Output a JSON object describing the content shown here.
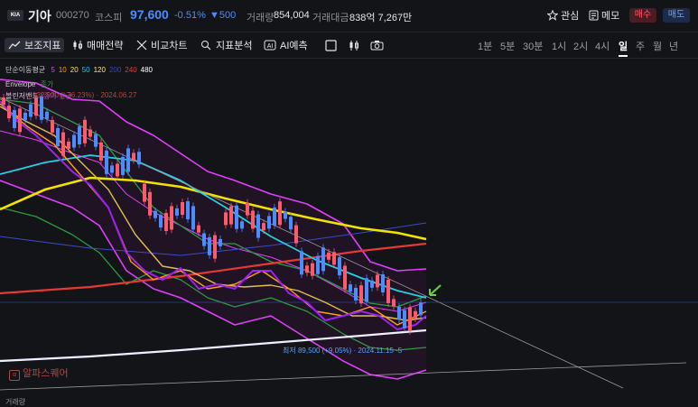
{
  "header": {
    "logo_text": "KIA",
    "name": "기아",
    "code": "000270",
    "market": "코스피",
    "price": "97,600",
    "change_rate": "-0.51%",
    "change_value": "▼500",
    "volume_label": "거래량",
    "volume": "854,004",
    "amount_label": "거래대금",
    "amount": "838억 7,267만",
    "watch_label": "관심",
    "memo_label": "메모",
    "buy_label": "매수",
    "sell_label": "매도"
  },
  "toolbar": {
    "tools": [
      "보조지표",
      "매매전략",
      "비교차트",
      "지표분석",
      "AI예측"
    ],
    "periods": [
      "1분",
      "5분",
      "30분",
      "1시",
      "2시",
      "4시",
      "일",
      "주",
      "월",
      "년"
    ],
    "active_period": "일"
  },
  "legend": {
    "ma_label": "단순이동평균",
    "ma_periods": [
      "5",
      "10",
      "20",
      "50",
      "120",
      "200",
      "240",
      "480"
    ],
    "ma_colors": [
      "#e040fb",
      "#ff9800",
      "#ffeb3b",
      "#26c6da",
      "#ffee58",
      "#3949ab",
      "#e53935",
      "#ffffff"
    ],
    "envelope_label": "Envelope",
    "envelope_suffix": "종가",
    "bollinger_label": "볼린저밴드",
    "bollinger_suffix": "종가 평균",
    "bollinger_annotation": "132,900 (+36.23%) · 2024.06.27"
  },
  "chart": {
    "low_annotation": "최저 89,500 (+9.05%) · 2024.11.15 ·5",
    "watermark": "알파스퀘어",
    "bottom_label": "거래량",
    "colors": {
      "up": "#ff5a6b",
      "down": "#4d8cff",
      "ma200": "#3d4bc9",
      "ma240": "#e53935",
      "ma120": "#f2e400",
      "ma50": "#25d0e0",
      "ma480": "#f0f0ff",
      "boll": "#e040fb",
      "env": "#2e9a43",
      "ma5": "#a020f0",
      "ma10": "#ff9f1a",
      "ma20": "#e0c050"
    }
  }
}
